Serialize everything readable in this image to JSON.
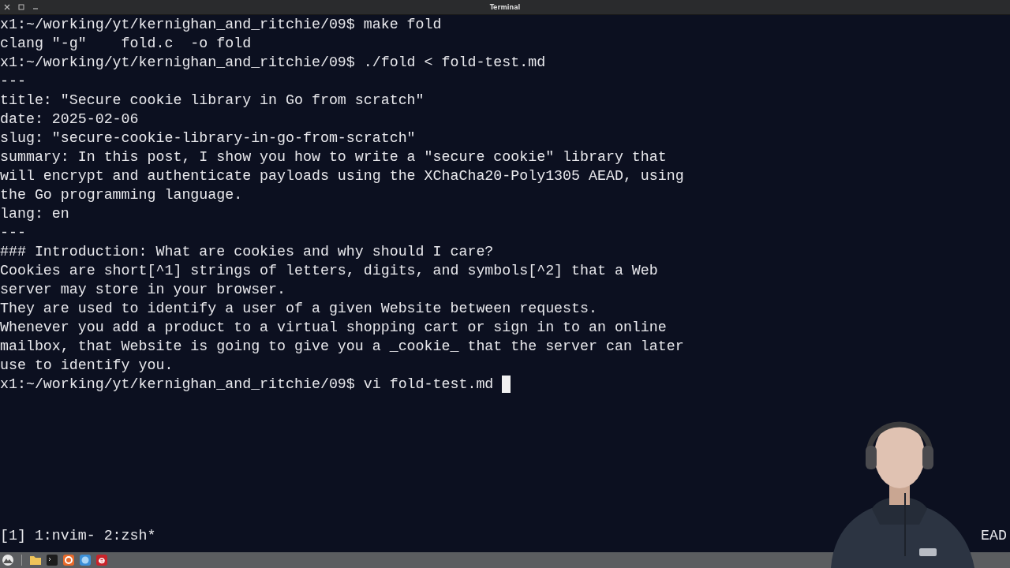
{
  "window": {
    "title": "Terminal"
  },
  "terminal": {
    "lines": [
      "x1:~/working/yt/kernighan_and_ritchie/09$ make fold",
      "clang \"-g\"    fold.c  -o fold",
      "x1:~/working/yt/kernighan_and_ritchie/09$ ./fold < fold-test.md",
      "---",
      "title: \"Secure cookie library in Go from scratch\"",
      "date: 2025-02-06",
      "slug: \"secure-cookie-library-in-go-from-scratch\"",
      "summary: In this post, I show you how to write a \"secure cookie\" library that",
      "will encrypt and authenticate payloads using the XChaCha20-Poly1305 AEAD, using",
      "the Go programming language.",
      "lang: en",
      "---",
      "### Introduction: What are cookies and why should I care?",
      "Cookies are short[^1] strings of letters, digits, and symbols[^2] that a Web",
      "server may store in your browser.",
      "They are used to identify a user of a given Website between requests.",
      "Whenever you add a product to a virtual shopping cart or sign in to an online",
      "mailbox, that Website is going to give you a _cookie_ that the server can later",
      "use to identify you."
    ],
    "input_line": {
      "text": "x1:~/working/yt/kernighan_and_ritchie/09$ vi fold-test.md",
      "cursor": true
    },
    "status_bar": {
      "windows": "[1] 1:nvim- 2:zsh*",
      "right_text": "EAD"
    }
  },
  "taskbar": {
    "apps": [
      {
        "kind": "launcher"
      },
      {
        "kind": "folder"
      },
      {
        "kind": "terminal"
      },
      {
        "kind": "firefox"
      },
      {
        "kind": "browser"
      },
      {
        "kind": "editor"
      }
    ]
  }
}
